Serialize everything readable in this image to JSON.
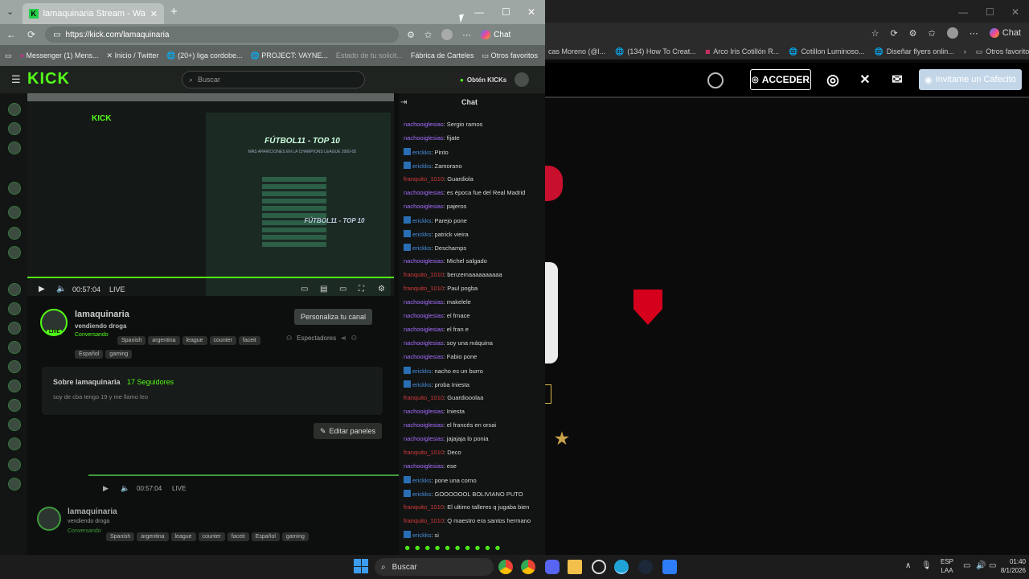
{
  "main_window": {
    "tab_title": "lamaquinaria Stream - Watch Live",
    "url": "https://kick.com/lamaquinaria",
    "chat_button": "Chat",
    "bookmarks": [
      "Messenger (1) Mens...",
      "Inicio / Twitter",
      "(20+) liga cordobe...",
      "PROJECT: VAYNE...",
      "Estado de tu solicit...",
      "Fábrica de Carteles",
      "Otros favoritos"
    ]
  },
  "kick": {
    "search_placeholder": "Buscar",
    "get_kicks": "Obtén KICKs",
    "video_time": "00:57:04",
    "live_label": "LIVE",
    "personalize": "Personaliza tu canal",
    "viewers_label": "Espectadores",
    "channel_name": "lamaquinaria",
    "stream_title": "vendiendo droga",
    "category": "Conversando",
    "tags": [
      "Spanish",
      "argentina",
      "league",
      "counter",
      "faceit",
      "Español",
      "gaming"
    ],
    "about_title": "Sobre lamaquinaria",
    "followers": "17 Seguidores",
    "bio": "soy de cba tengo 19 y me llamo leo",
    "edit_panels": "Editar paneles",
    "nested_video_time": "00:57:04",
    "nested_live": "LIVE",
    "nested_channel_name": "lamaquinaria",
    "nested_title": "vendiendo droga",
    "nested_category": "Conversando",
    "nested_tags": [
      "Spanish",
      "argentina",
      "league",
      "counter",
      "faceit",
      "Español",
      "gaming"
    ]
  },
  "nested_stream": {
    "title_lines": [
      "FÚTBOL11 - TOP 10",
      "MÁS APARICIONES EN LA CHAMPIONS LEAGUE 2000-05"
    ],
    "subtitle": "FÚTBOL11 - TOP 10"
  },
  "chat": {
    "title": "Chat",
    "messages": [
      {
        "user": "nachooiglesias",
        "color": "purple",
        "text": "Sergio ramos"
      },
      {
        "user": "nachooiglesias",
        "color": "purple",
        "text": "fijate"
      },
      {
        "user": "erickks",
        "color": "blue",
        "text": "Pinto"
      },
      {
        "user": "erickks",
        "color": "blue",
        "text": "Zamorano"
      },
      {
        "user": "franquito_1010",
        "color": "red",
        "text": "Guardiola"
      },
      {
        "user": "nachooiglesias",
        "color": "purple",
        "text": "es época fue del Real Madrid"
      },
      {
        "user": "nachooiglesias",
        "color": "purple",
        "text": "pajeros"
      },
      {
        "user": "erickks",
        "color": "blue",
        "text": "Parejo pone"
      },
      {
        "user": "erickks",
        "color": "blue",
        "text": "patrick vieira"
      },
      {
        "user": "erickks",
        "color": "blue",
        "text": "Deschamps"
      },
      {
        "user": "nachooiglesias",
        "color": "purple",
        "text": "Michel salgado"
      },
      {
        "user": "franquito_1010",
        "color": "red",
        "text": "benzemaaaaaaaaaa"
      },
      {
        "user": "franquito_1010",
        "color": "red",
        "text": "Paul pogba"
      },
      {
        "user": "nachooiglesias",
        "color": "purple",
        "text": "makelele"
      },
      {
        "user": "nachooiglesias",
        "color": "purple",
        "text": "el frnace"
      },
      {
        "user": "nachooiglesias",
        "color": "purple",
        "text": "el fran e"
      },
      {
        "user": "nachooiglesias",
        "color": "purple",
        "text": "soy una máquina"
      },
      {
        "user": "nachooiglesias",
        "color": "purple",
        "text": "Fabio pone"
      },
      {
        "user": "erickks",
        "color": "blue",
        "text": "nacho es un burro"
      },
      {
        "user": "erickks",
        "color": "blue",
        "text": "proba Iniesta"
      },
      {
        "user": "franquito_1010",
        "color": "red",
        "text": "Guardiooolaa"
      },
      {
        "user": "nachooiglesias",
        "color": "purple",
        "text": "Iniesta"
      },
      {
        "user": "nachooiglesias",
        "color": "purple",
        "text": "el francés en orsai"
      },
      {
        "user": "nachooiglesias",
        "color": "purple",
        "text": "jajajaja lo ponia"
      },
      {
        "user": "franquito_1010",
        "color": "red",
        "text": "Deco"
      },
      {
        "user": "nachooiglesias",
        "color": "purple",
        "text": "ese"
      },
      {
        "user": "erickks",
        "color": "blue",
        "text": "pone una corno"
      },
      {
        "user": "erickks",
        "color": "blue",
        "text": "GOOOOOOL BOLIVIANO PUTO"
      },
      {
        "user": "franquito_1010",
        "color": "red",
        "text": "El ultimo talleres q jugaba bien"
      },
      {
        "user": "franquito_1010",
        "color": "red",
        "text": "Q maestro era santos hermano"
      },
      {
        "user": "erickks",
        "color": "blue",
        "text": "si"
      }
    ]
  },
  "background_browser": {
    "bookmarks": [
      "cas Moreno (@l...",
      "(134) How To Creat...",
      "Arco Iris Cotillón R...",
      "Cotillon Luminoso...",
      "Diseñar flyers onlin...",
      "Otros favoritos"
    ],
    "chat_button": "Chat",
    "login_button": "ACCEDER",
    "coffee_button": "Invitame un Cafecito"
  },
  "taskbar": {
    "search": "Buscar",
    "lang_top": "ESP",
    "lang_bottom": "LAA",
    "time": "01:40",
    "date": "8/1/2026"
  }
}
